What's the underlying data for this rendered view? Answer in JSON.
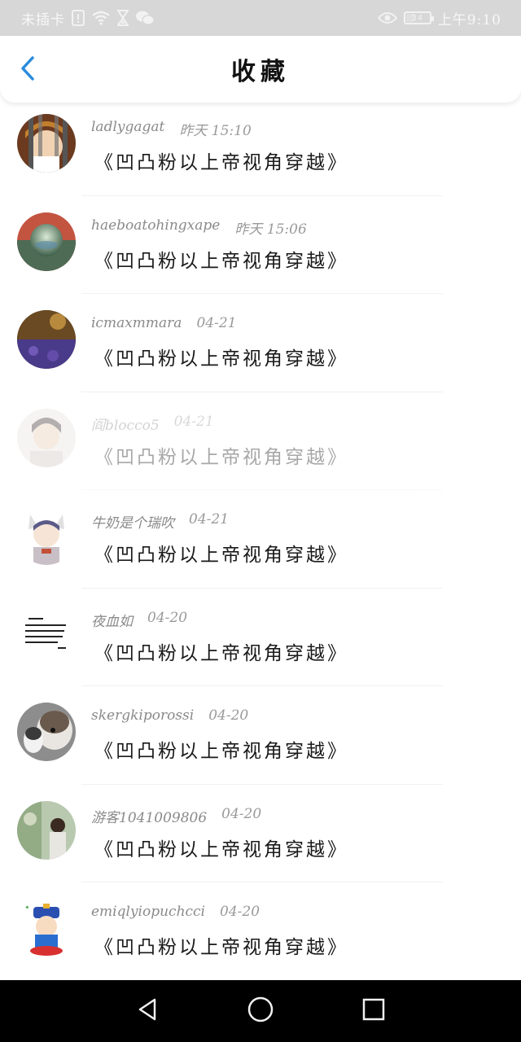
{
  "status_bar": {
    "carrier": "未插卡",
    "battery": "34",
    "time": "上午9:10"
  },
  "header": {
    "title": "收藏",
    "back_icon": "chevron-left-icon"
  },
  "colors": {
    "accent": "#2a8bdc",
    "status_bar_bg": "#d7d7d7",
    "nav_bar_bg": "#000000"
  },
  "favorites": [
    {
      "user": "ladlygagat",
      "time": "昨天 15:10",
      "content": "《凹凸粉以上帝视角穿越》"
    },
    {
      "user": "haeboatohingxape",
      "time": "昨天 15:06",
      "content": "《凹凸粉以上帝视角穿越》"
    },
    {
      "user": "icmaxmmara",
      "time": "04-21",
      "content": "《凹凸粉以上帝视角穿越》"
    },
    {
      "user": "阎blocco5",
      "time": "04-21",
      "content": "《凹凸粉以上帝视角穿越》"
    },
    {
      "user": "牛奶是个瑞吹",
      "time": "04-21",
      "content": "《凹凸粉以上帝视角穿越》"
    },
    {
      "user": "夜血如",
      "time": "04-20",
      "content": "《凹凸粉以上帝视角穿越》"
    },
    {
      "user": "skergkiporossi",
      "time": "04-20",
      "content": "《凹凸粉以上帝视角穿越》"
    },
    {
      "user": "游客1041009806",
      "time": "04-20",
      "content": "《凹凸粉以上帝视角穿越》"
    },
    {
      "user": "emiqlyiopuchcci",
      "time": "04-20",
      "content": "《凹凸粉以上帝视角穿越》"
    }
  ],
  "nav_bar": {
    "back": "triangle-back-icon",
    "home": "circle-home-icon",
    "recents": "square-recents-icon"
  }
}
